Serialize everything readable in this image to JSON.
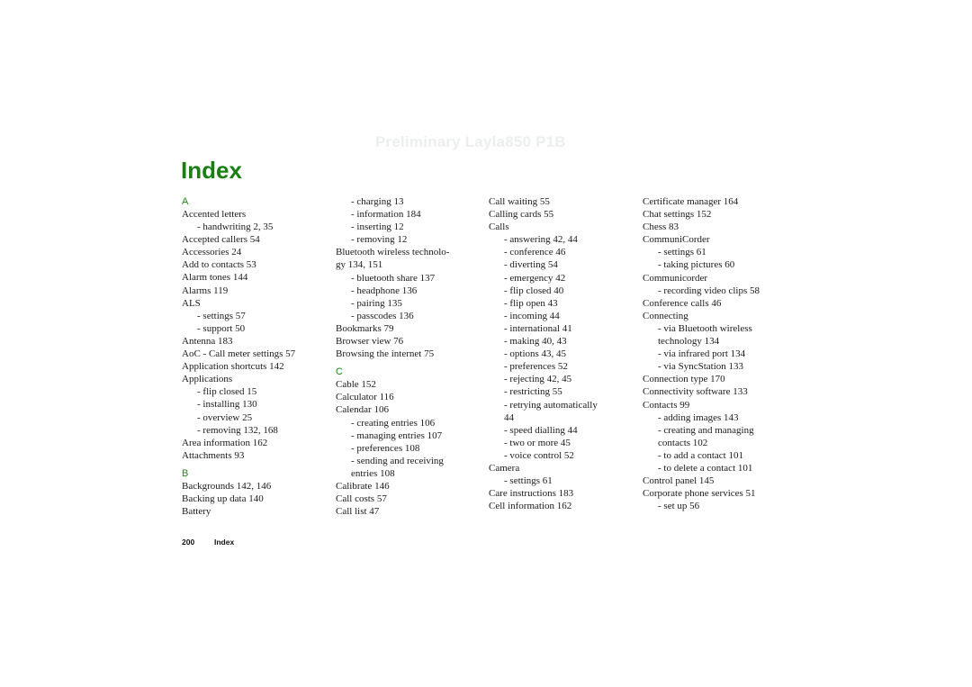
{
  "watermark": "Preliminary Layla850 P1B",
  "title": "Index",
  "colors": {
    "accent": "#1a7f12",
    "watermark": "#eceeee",
    "text": "#1a1a1a"
  },
  "columns": [
    [
      {
        "type": "letter",
        "text": "A"
      },
      {
        "type": "entry",
        "text": "Accented letters"
      },
      {
        "type": "sub",
        "text": "- handwriting 2, 35"
      },
      {
        "type": "entry",
        "text": "Accepted callers 54"
      },
      {
        "type": "entry",
        "text": "Accessories 24"
      },
      {
        "type": "entry",
        "text": "Add to contacts 53"
      },
      {
        "type": "entry",
        "text": "Alarm tones 144"
      },
      {
        "type": "entry",
        "text": "Alarms 119"
      },
      {
        "type": "entry",
        "text": "ALS"
      },
      {
        "type": "sub",
        "text": "- settings 57"
      },
      {
        "type": "sub",
        "text": "- support 50"
      },
      {
        "type": "entry",
        "text": "Antenna 183"
      },
      {
        "type": "entry",
        "text": "AoC - Call meter settings 57"
      },
      {
        "type": "entry",
        "text": "Application shortcuts 142"
      },
      {
        "type": "entry",
        "text": "Applications"
      },
      {
        "type": "sub",
        "text": "- flip closed 15"
      },
      {
        "type": "sub",
        "text": "- installing 130"
      },
      {
        "type": "sub",
        "text": "- overview 25"
      },
      {
        "type": "sub",
        "text": "- removing 132, 168"
      },
      {
        "type": "entry",
        "text": "Area information 162"
      },
      {
        "type": "entry",
        "text": "Attachments 93"
      },
      {
        "type": "letter",
        "text": "B"
      },
      {
        "type": "entry",
        "text": "Backgrounds 142, 146"
      },
      {
        "type": "entry",
        "text": "Backing up data 140"
      },
      {
        "type": "entry",
        "text": "Battery"
      }
    ],
    [
      {
        "type": "sub",
        "text": "- charging 13"
      },
      {
        "type": "sub",
        "text": "- information 184"
      },
      {
        "type": "sub",
        "text": "- inserting 12"
      },
      {
        "type": "sub",
        "text": "- removing 12"
      },
      {
        "type": "entry",
        "text": "Bluetooth wireless technolo-"
      },
      {
        "type": "cont",
        "text": "gy 134, 151"
      },
      {
        "type": "sub",
        "text": "- bluetooth share 137"
      },
      {
        "type": "sub",
        "text": "- headphone 136"
      },
      {
        "type": "sub",
        "text": "- pairing 135"
      },
      {
        "type": "sub",
        "text": "- passcodes 136"
      },
      {
        "type": "entry",
        "text": "Bookmarks 79"
      },
      {
        "type": "entry",
        "text": "Browser view 76"
      },
      {
        "type": "entry",
        "text": "Browsing the internet 75"
      },
      {
        "type": "letter",
        "text": "C"
      },
      {
        "type": "entry",
        "text": "Cable 152"
      },
      {
        "type": "entry",
        "text": "Calculator 116"
      },
      {
        "type": "entry",
        "text": "Calendar 106"
      },
      {
        "type": "sub",
        "text": "- creating entries 106"
      },
      {
        "type": "sub",
        "text": "- managing entries 107"
      },
      {
        "type": "sub",
        "text": "- preferences 108"
      },
      {
        "type": "sub",
        "text": "- sending and receiving"
      },
      {
        "type": "subcont",
        "text": "entries 108"
      },
      {
        "type": "entry",
        "text": "Calibrate 146"
      },
      {
        "type": "entry",
        "text": "Call costs 57"
      },
      {
        "type": "entry",
        "text": "Call list 47"
      }
    ],
    [
      {
        "type": "entry",
        "text": "Call waiting 55"
      },
      {
        "type": "entry",
        "text": "Calling cards 55"
      },
      {
        "type": "entry",
        "text": "Calls"
      },
      {
        "type": "sub",
        "text": "- answering 42, 44"
      },
      {
        "type": "sub",
        "text": "- conference 46"
      },
      {
        "type": "sub",
        "text": "- diverting 54"
      },
      {
        "type": "sub",
        "text": "- emergency 42"
      },
      {
        "type": "sub",
        "text": "- flip closed 40"
      },
      {
        "type": "sub",
        "text": "- flip open 43"
      },
      {
        "type": "sub",
        "text": "- incoming 44"
      },
      {
        "type": "sub",
        "text": "- international 41"
      },
      {
        "type": "sub",
        "text": "- making 40, 43"
      },
      {
        "type": "sub",
        "text": "- options 43, 45"
      },
      {
        "type": "sub",
        "text": "- preferences 52"
      },
      {
        "type": "sub",
        "text": "- rejecting 42, 45"
      },
      {
        "type": "sub",
        "text": "- restricting 55"
      },
      {
        "type": "sub",
        "text": "- retrying automatically"
      },
      {
        "type": "subcont",
        "text": "44"
      },
      {
        "type": "sub",
        "text": "- speed dialling 44"
      },
      {
        "type": "sub",
        "text": "- two or more 45"
      },
      {
        "type": "sub",
        "text": "- voice control 52"
      },
      {
        "type": "entry",
        "text": "Camera"
      },
      {
        "type": "sub",
        "text": "- settings 61"
      },
      {
        "type": "entry",
        "text": "Care instructions 183"
      },
      {
        "type": "entry",
        "text": "Cell information 162"
      }
    ],
    [
      {
        "type": "entry",
        "text": "Certificate manager 164"
      },
      {
        "type": "entry",
        "text": "Chat settings 152"
      },
      {
        "type": "entry",
        "text": "Chess 83"
      },
      {
        "type": "entry",
        "text": "CommuniCorder"
      },
      {
        "type": "sub",
        "text": "- settings 61"
      },
      {
        "type": "sub",
        "text": "- taking pictures 60"
      },
      {
        "type": "entry",
        "text": "Communicorder"
      },
      {
        "type": "sub",
        "text": "- recording video clips 58"
      },
      {
        "type": "entry",
        "text": "Conference calls 46"
      },
      {
        "type": "entry",
        "text": "Connecting"
      },
      {
        "type": "sub",
        "text": "- via Bluetooth wireless"
      },
      {
        "type": "subcont",
        "text": "technology 134"
      },
      {
        "type": "sub",
        "text": "- via infrared port 134"
      },
      {
        "type": "sub",
        "text": "- via SyncStation 133"
      },
      {
        "type": "entry",
        "text": "Connection type 170"
      },
      {
        "type": "entry",
        "text": "Connectivity software 133"
      },
      {
        "type": "entry",
        "text": "Contacts 99"
      },
      {
        "type": "sub",
        "text": "- adding images 143"
      },
      {
        "type": "sub",
        "text": "- creating and managing"
      },
      {
        "type": "subcont",
        "text": "contacts 102"
      },
      {
        "type": "sub",
        "text": "- to add a contact 101"
      },
      {
        "type": "sub",
        "text": "- to delete a contact 101"
      },
      {
        "type": "entry",
        "text": "Control panel 145"
      },
      {
        "type": "entry",
        "text": "Corporate phone services 51"
      },
      {
        "type": "sub",
        "text": "- set up 56"
      }
    ]
  ],
  "footer": {
    "page_number": "200",
    "section": "Index"
  }
}
